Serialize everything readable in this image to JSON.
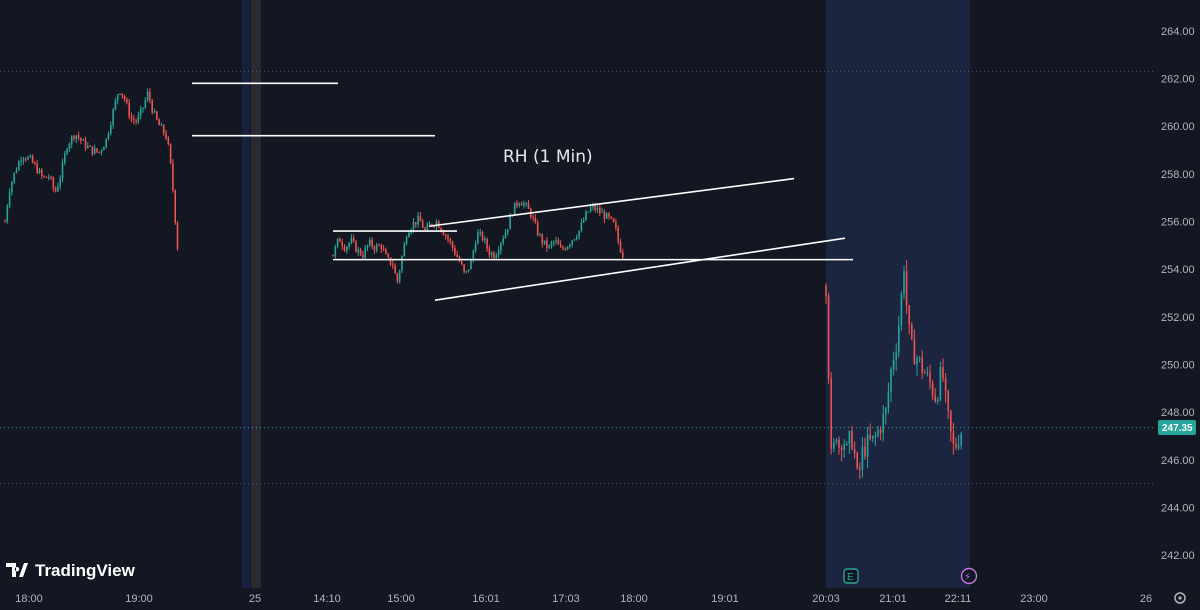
{
  "chart_data": {
    "type": "candlestick",
    "title": "",
    "annotation": "RH (1 Min)",
    "brand": "TradingView",
    "last_price_label": "247.35",
    "last_price": 247.35,
    "ylim": [
      241.0,
      265.0
    ],
    "y_ticks": [
      "242.00",
      "244.00",
      "246.00",
      "248.00",
      "250.00",
      "252.00",
      "254.00",
      "256.00",
      "258.00",
      "260.00",
      "262.00",
      "264.00"
    ],
    "x_ticks": [
      "18:00",
      "19:00",
      "25",
      "14:10",
      "15:00",
      "16:01",
      "17:03",
      "18:00",
      "19:01",
      "20:03",
      "21:01",
      "22:11",
      "23:00",
      "26"
    ],
    "reference_levels": [
      262.3,
      245.0
    ],
    "session_segments": [
      {
        "phase": "previous day",
        "points": [
          [
            0,
            256.0
          ],
          [
            4,
            257.3
          ],
          [
            10,
            258.1
          ],
          [
            17,
            258.8
          ],
          [
            25,
            258.6
          ],
          [
            32,
            258.2
          ],
          [
            38,
            257.8
          ],
          [
            44,
            257.9
          ],
          [
            50,
            257.2
          ],
          [
            56,
            258.0
          ],
          [
            62,
            259.2
          ],
          [
            70,
            259.7
          ],
          [
            78,
            259.3
          ],
          [
            86,
            259.0
          ],
          [
            94,
            258.9
          ],
          [
            101,
            259.4
          ],
          [
            108,
            260.6
          ],
          [
            114,
            261.6
          ],
          [
            120,
            261.1
          ],
          [
            126,
            260.3
          ],
          [
            132,
            260.2
          ],
          [
            138,
            260.8
          ],
          [
            143,
            261.4
          ],
          [
            148,
            260.6
          ],
          [
            153,
            260.1
          ],
          [
            158,
            259.8
          ],
          [
            162,
            259.5
          ],
          [
            165,
            258.6
          ],
          [
            168,
            257.3
          ],
          [
            170,
            256.2
          ],
          [
            172,
            255.1
          ],
          [
            174,
            254.5
          ]
        ]
      },
      {
        "phase": "day session",
        "points": [
          [
            0,
            254.6
          ],
          [
            6,
            255.3
          ],
          [
            12,
            254.9
          ],
          [
            18,
            255.2
          ],
          [
            24,
            254.8
          ],
          [
            30,
            254.6
          ],
          [
            36,
            255.1
          ],
          [
            42,
            254.9
          ],
          [
            48,
            255.0
          ],
          [
            54,
            254.4
          ],
          [
            60,
            254.2
          ],
          [
            64,
            253.4
          ],
          [
            68,
            254.3
          ],
          [
            74,
            255.6
          ],
          [
            80,
            255.9
          ],
          [
            86,
            256.1
          ],
          [
            92,
            255.6
          ],
          [
            98,
            255.9
          ],
          [
            104,
            256.0
          ],
          [
            110,
            255.6
          ],
          [
            116,
            255.2
          ],
          [
            122,
            254.7
          ],
          [
            128,
            254.2
          ],
          [
            132,
            253.7
          ],
          [
            138,
            254.3
          ],
          [
            144,
            255.5
          ],
          [
            150,
            255.3
          ],
          [
            156,
            254.7
          ],
          [
            162,
            254.6
          ],
          [
            168,
            255.2
          ],
          [
            174,
            255.7
          ],
          [
            180,
            256.5
          ],
          [
            186,
            256.9
          ],
          [
            192,
            256.7
          ],
          [
            198,
            256.3
          ],
          [
            204,
            255.6
          ],
          [
            210,
            255.1
          ],
          [
            216,
            254.9
          ],
          [
            222,
            255.2
          ],
          [
            228,
            254.8
          ],
          [
            234,
            255.0
          ],
          [
            240,
            255.3
          ],
          [
            246,
            255.6
          ],
          [
            252,
            256.2
          ],
          [
            258,
            256.6
          ],
          [
            264,
            256.5
          ],
          [
            270,
            256.3
          ],
          [
            276,
            256.1
          ],
          [
            282,
            255.8
          ],
          [
            286,
            255.0
          ],
          [
            290,
            254.6
          ]
        ]
      },
      {
        "phase": "after hours",
        "points": [
          [
            0,
            253.3
          ],
          [
            3,
            249.2
          ],
          [
            6,
            245.0
          ],
          [
            9,
            247.5
          ],
          [
            13,
            246.6
          ],
          [
            17,
            247.0
          ],
          [
            21,
            246.3
          ],
          [
            25,
            247.1
          ],
          [
            29,
            246.1
          ],
          [
            32,
            245.0
          ],
          [
            36,
            246.3
          ],
          [
            42,
            246.7
          ],
          [
            48,
            246.8
          ],
          [
            54,
            247.4
          ],
          [
            60,
            248.0
          ],
          [
            66,
            250.1
          ],
          [
            70,
            250.8
          ],
          [
            74,
            252.1
          ],
          [
            78,
            254.2
          ],
          [
            82,
            251.6
          ],
          [
            86,
            250.6
          ],
          [
            92,
            250.2
          ],
          [
            98,
            249.7
          ],
          [
            104,
            249.2
          ],
          [
            110,
            248.6
          ],
          [
            116,
            249.8
          ],
          [
            120,
            248.3
          ],
          [
            124,
            247.2
          ],
          [
            128,
            246.4
          ],
          [
            132,
            246.9
          ],
          [
            136,
            247.3
          ]
        ]
      }
    ],
    "trendlines": [
      {
        "label": "upper resistance",
        "from": [
          -3,
          261.8
        ],
        "to": [
          143,
          261.8
        ]
      },
      {
        "label": "upper support",
        "from": [
          -3,
          259.6
        ],
        "to": [
          240,
          259.6
        ]
      },
      {
        "label": "range top",
        "from": [
          0,
          255.6
        ],
        "to": [
          124,
          255.6
        ]
      },
      {
        "label": "range bottom",
        "from": [
          0,
          254.4
        ],
        "to": [
          520,
          254.4
        ]
      },
      {
        "label": "channel top",
        "from": [
          96,
          255.8
        ],
        "to": [
          461,
          257.8
        ]
      },
      {
        "label": "channel bottom",
        "from": [
          102,
          252.7
        ],
        "to": [
          512,
          255.3
        ]
      }
    ],
    "markers": [
      {
        "type": "earnings",
        "label": "E"
      },
      {
        "type": "dividend-lightning",
        "label": "⚡"
      }
    ],
    "grid": false,
    "legend": "none"
  },
  "colors": {
    "background": "#131722",
    "up": "#26a69a",
    "down": "#ef5350",
    "axis_text": "#b2b5be",
    "lines": "#ffffff",
    "extended_session": "#1f2a44",
    "last_price": "#26a69a",
    "reference_line": "#4f5a66"
  }
}
